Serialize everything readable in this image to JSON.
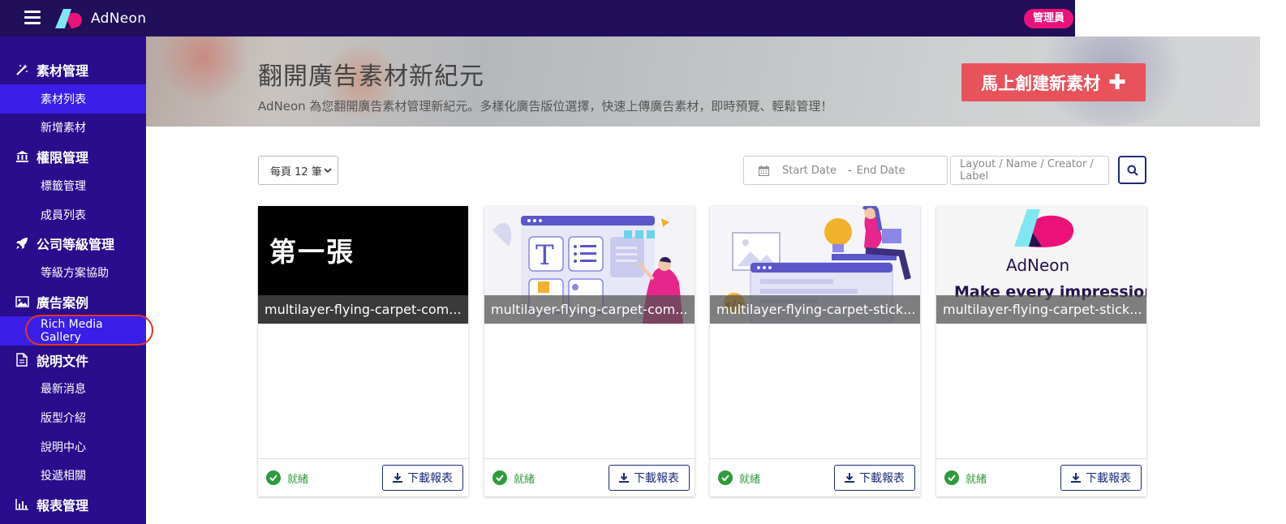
{
  "header": {
    "logo_text": "AdNeon",
    "admin_badge": "管理員"
  },
  "sidebar": {
    "groups": [
      {
        "label": "素材管理",
        "icon": "magic-wand-icon",
        "items": [
          "素材列表",
          "新增素材"
        ]
      },
      {
        "label": "權限管理",
        "icon": "bank-icon",
        "items": [
          "標籤管理",
          "成員列表"
        ]
      },
      {
        "label": "公司等級管理",
        "icon": "rocket-icon",
        "items": [
          "等級方案協助"
        ]
      },
      {
        "label": "廣告案例",
        "icon": "image-icon",
        "items": [
          "Rich Media Gallery"
        ]
      },
      {
        "label": "說明文件",
        "icon": "file-icon",
        "items": [
          "最新消息",
          "版型介紹",
          "說明中心",
          "投遞相關"
        ]
      },
      {
        "label": "報表管理",
        "icon": "bar-chart-icon",
        "items": []
      }
    ]
  },
  "hero": {
    "title": "翻開廣告素材新紀元",
    "subtitle": "AdNeon 為您翻開廣告素材管理新紀元。多樣化廣告版位選擇，快速上傳廣告素材，即時預覽、輕鬆管理！",
    "create_button": "馬上創建新素材"
  },
  "filters": {
    "per_page": "每頁 12 筆",
    "start_date_placeholder": "Start Date",
    "date_separator": "-",
    "end_date_placeholder": "End Date",
    "search_placeholder": "Layout / Name / Creator / Label"
  },
  "cards": [
    {
      "thumb_text": "第一張",
      "title": "multilayer-flying-carpet-com...",
      "status": "就緒",
      "download": "下載報表"
    },
    {
      "thumb_text": "",
      "title": "multilayer-flying-carpet-com...",
      "status": "就緒",
      "download": "下載報表"
    },
    {
      "thumb_text": "",
      "title": "multilayer-flying-carpet-stick...",
      "status": "就緒",
      "download": "下載報表"
    },
    {
      "thumb_text": "AdNeon",
      "thumb_tagline": "Make every impression",
      "title": "multilayer-flying-carpet-stick...",
      "status": "就緒",
      "download": "下載報表"
    }
  ],
  "colors": {
    "sidebar": "#2a0d8c",
    "topbar": "#210f5a",
    "active_item": "#3a1ee8",
    "create_button": "#e8525b",
    "admin_badge": "#ec1178",
    "status_ready": "#2e9b3a",
    "button_border": "#1d2b7a"
  }
}
